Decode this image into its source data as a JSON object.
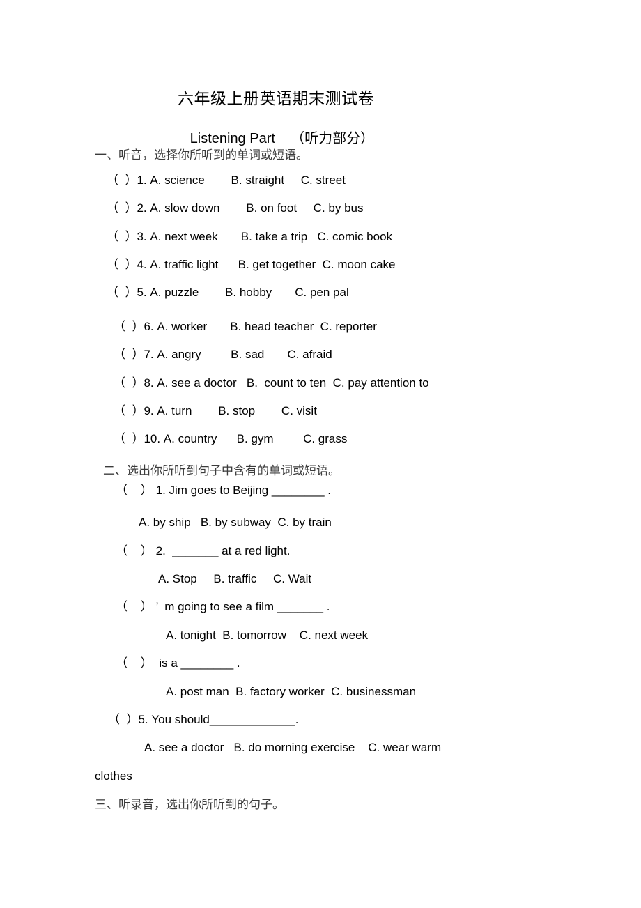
{
  "document": {
    "title": "六年级上册英语期末测试卷",
    "subtitle_en": "Listening Part",
    "subtitle_cn": "（听力部分）"
  },
  "section_one": {
    "heading": "一、听音，选择你所听到的单词或短语。",
    "questions": [
      "（  ）1. A. science        B. straight     C. street",
      "（  ）2. A. slow down        B. on foot     C. by bus",
      "（  ）3. A. next week       B. take a trip   C. comic book",
      "（  ）4. A. traffic light      B. get together  C. moon cake",
      "（  ）5. A. puzzle        B. hobby       C. pen pal",
      "（  ）6. A. worker       B. head teacher  C. reporter",
      "（  ）7. A. angry         B. sad       C. afraid",
      "（  ）8. A. see a doctor   B.  count to ten  C. pay attention to",
      "（  ）9. A. turn        B. stop        C. visit",
      "（  ）10. A. country      B. gym         C. grass"
    ]
  },
  "section_two": {
    "heading": "二、选出你所听到句子中含有的单词或短语。",
    "items": [
      {
        "question": "（    ） 1. Jim goes to Beijing ________ .",
        "options": "A. by ship   B. by subway  C. by train"
      },
      {
        "question": "（    ） 2.  _______ at a red light.",
        "options": "A. Stop     B. traffic     C. Wait"
      },
      {
        "question": "（    ） ’  m going to see a film _______ .",
        "options": "A. tonight  B. tomorrow    C. next week"
      },
      {
        "question": "（    ）  is a ________ .",
        "options": "A. post man  B. factory worker  C. businessman"
      },
      {
        "question": "（  ）5. You should_____________.",
        "options": "A. see a doctor   B. do morning exercise    C. wear warm",
        "options_wrap": "clothes"
      }
    ]
  },
  "section_three": {
    "heading": "三、听录音，选出你所听到的句子。"
  }
}
